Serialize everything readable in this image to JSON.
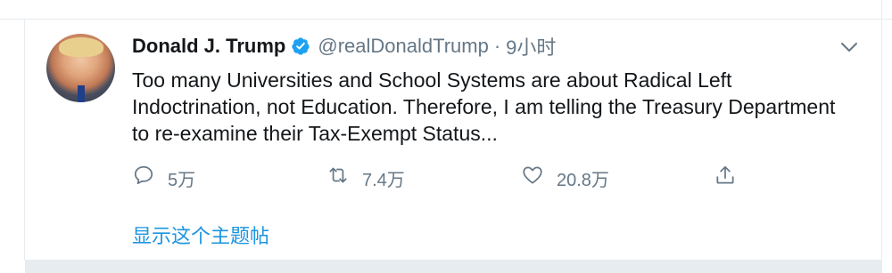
{
  "tweet": {
    "author_name": "Donald J. Trump",
    "handle": "@realDonaldTrump",
    "separator": "·",
    "time": "9小时",
    "text": "Too many Universities and School Systems are about Radical Left Indoctrination, not Education. Therefore, I am telling the Treasury Department to re-examine their Tax-Exempt Status...",
    "actions": {
      "reply_count": "5万",
      "retweet_count": "7.4万",
      "like_count": "20.8万"
    },
    "show_thread_label": "显示这个主题帖"
  },
  "colors": {
    "accent": "#1b95e0",
    "verified": "#1da1f2",
    "muted": "#657786",
    "text": "#14171a",
    "border": "#e6ecf0"
  },
  "icons": [
    "verified-badge-icon",
    "chevron-down-icon",
    "reply-icon",
    "retweet-icon",
    "like-icon",
    "share-icon"
  ]
}
